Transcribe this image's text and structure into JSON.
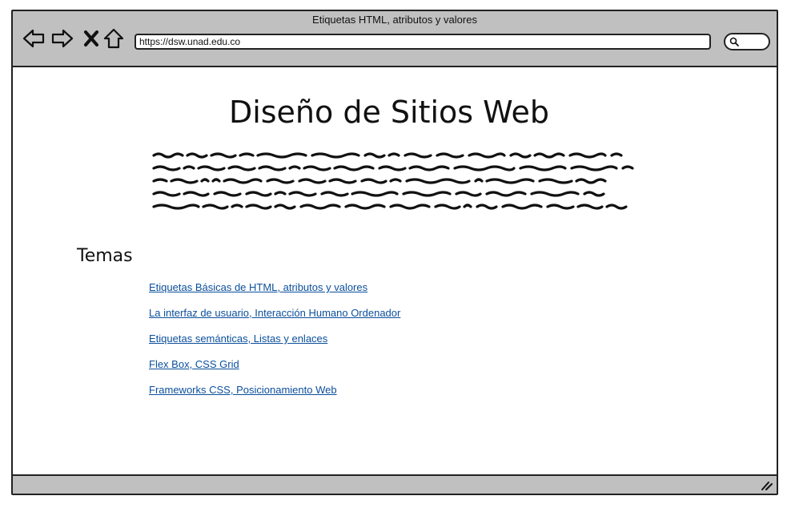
{
  "window": {
    "title": "Etiquetas HTML, atributos y valores"
  },
  "toolbar": {
    "url": "https://dsw.unad.edu.co",
    "icons": [
      "back-arrow-icon",
      "forward-arrow-icon",
      "close-x-icon",
      "home-icon",
      "search-icon"
    ]
  },
  "page": {
    "title": "Diseño de Sitios Web",
    "section_title": "Temas",
    "links": [
      "Etiquetas Básicas de HTML, atributos y valores",
      "La interfaz de usuario, Interacción Humano Ordenador",
      "Etiquetas semánticas, Listas y enlaces",
      "Flex Box, CSS Grid",
      "Frameworks CSS, Posicionamiento Web"
    ]
  },
  "colors": {
    "chrome": "#c0c0c0",
    "link": "#0b4f9c",
    "border": "#222222"
  }
}
